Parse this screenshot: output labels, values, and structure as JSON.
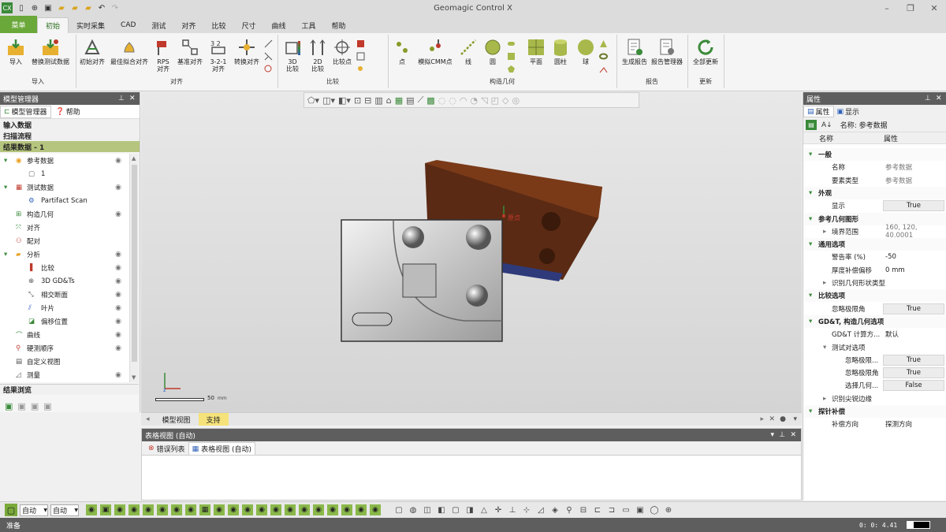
{
  "app": {
    "title": "Geomagic Control X",
    "logo": "CX"
  },
  "tabs": [
    "菜单",
    "初始",
    "实时采集",
    "CAD",
    "测试",
    "对齐",
    "比较",
    "尺寸",
    "曲线",
    "工具",
    "帮助"
  ],
  "ribbon": {
    "import": {
      "import_label": "导入",
      "replace_label": "替换测试数据",
      "group": "导入"
    },
    "align": {
      "initial": "初始对齐",
      "bestfit": "最佳拟合对齐",
      "rps": "RPS\n对齐",
      "datum": "基准对齐",
      "three21": "3-2-1\n对齐",
      "transform": "转换对齐",
      "group": "对齐"
    },
    "compare": {
      "c3d": "3D\n比较",
      "c2d": "2D\n比较",
      "points": "比较点",
      "group": "比较"
    },
    "construct": {
      "point": "点",
      "cmm": "模拟CMM点",
      "line": "线",
      "circle": "圆",
      "plane": "平面",
      "cylinder": "圆柱",
      "sphere": "球",
      "group": "构造几何"
    },
    "report": {
      "generate": "生成报告",
      "manager": "报告管理器",
      "group": "报告"
    },
    "update": {
      "all": "全部更新",
      "group": "更新"
    }
  },
  "model_manager": {
    "title": "模型管理器",
    "tab_model": "模型管理器",
    "tab_help": "帮助",
    "sections": [
      "输入数据",
      "扫描流程",
      "结果数据 - 1"
    ],
    "tree": [
      {
        "label": "参考数据",
        "indent": 1
      },
      {
        "label": "1",
        "indent": 2
      },
      {
        "label": "测试数据",
        "indent": 1
      },
      {
        "label": "Partifact Scan",
        "indent": 2
      },
      {
        "label": "构造几何",
        "indent": 1
      },
      {
        "label": "对齐",
        "indent": 1
      },
      {
        "label": "配对",
        "indent": 1
      },
      {
        "label": "分析",
        "indent": 1
      },
      {
        "label": "比较",
        "indent": 2
      },
      {
        "label": "3D GD&Ts",
        "indent": 2
      },
      {
        "label": "相交断面",
        "indent": 2
      },
      {
        "label": "叶片",
        "indent": 2
      },
      {
        "label": "偏移位置",
        "indent": 2
      },
      {
        "label": "曲线",
        "indent": 1
      },
      {
        "label": "硬测顺序",
        "indent": 1
      },
      {
        "label": "自定义视图",
        "indent": 1
      },
      {
        "label": "测量",
        "indent": 1
      }
    ],
    "result_browse": "结果浏览"
  },
  "viewport": {
    "origin_label": "原点",
    "scale_value": "50",
    "scale_unit": "mm",
    "tab_model_view": "模型视图",
    "tab_support": "支持"
  },
  "table_view": {
    "title": "表格视图 (自动)",
    "tab_errors": "错误列表",
    "tab_table": "表格视图 (自动)"
  },
  "properties": {
    "title": "属性",
    "tab_props": "属性",
    "tab_display": "显示",
    "name_line": "名称: 参考数据",
    "col_name": "名称",
    "col_prop": "属性",
    "rows": [
      {
        "type": "cat",
        "name": "一般"
      },
      {
        "type": "row",
        "name": "名称",
        "value": "参考数据"
      },
      {
        "type": "row",
        "name": "要素类型",
        "value": "参考数据"
      },
      {
        "type": "cat",
        "name": "外观"
      },
      {
        "type": "row",
        "name": "显示",
        "value": "True",
        "box": true
      },
      {
        "type": "cat",
        "name": "参考几何图形"
      },
      {
        "type": "sub",
        "name": "境界范围",
        "value": "160, 120, 40.0001"
      },
      {
        "type": "cat",
        "name": "通用选项"
      },
      {
        "type": "row",
        "name": "警告率 (%)",
        "value": "-50"
      },
      {
        "type": "row",
        "name": "厚度补偿偏移",
        "value": "0 mm"
      },
      {
        "type": "sub",
        "name": "识别几何形状类型",
        "value": ""
      },
      {
        "type": "cat",
        "name": "比较选项"
      },
      {
        "type": "row",
        "name": "忽略极限角",
        "value": "True",
        "box": true
      },
      {
        "type": "cat",
        "name": "GD&T, 构造几何选项"
      },
      {
        "type": "row",
        "name": "GD&T 计算方...",
        "value": "默认"
      },
      {
        "type": "subcat",
        "name": "测试对选项"
      },
      {
        "type": "row2",
        "name": "忽略极限...",
        "value": "True",
        "box": true
      },
      {
        "type": "row2",
        "name": "忽略极限角",
        "value": "True",
        "box": true
      },
      {
        "type": "row2",
        "name": "选择几何...",
        "value": "False",
        "box": true
      },
      {
        "type": "sub",
        "name": "识别尖锐边缘",
        "value": ""
      },
      {
        "type": "cat",
        "name": "探针补偿"
      },
      {
        "type": "row",
        "name": "补偿方向",
        "value": "探测方向"
      }
    ]
  },
  "bottom_toolbar": {
    "sel1": "自动",
    "sel2": "自动"
  },
  "status": {
    "left": "准备",
    "coords": "0: 0: 4.41"
  }
}
